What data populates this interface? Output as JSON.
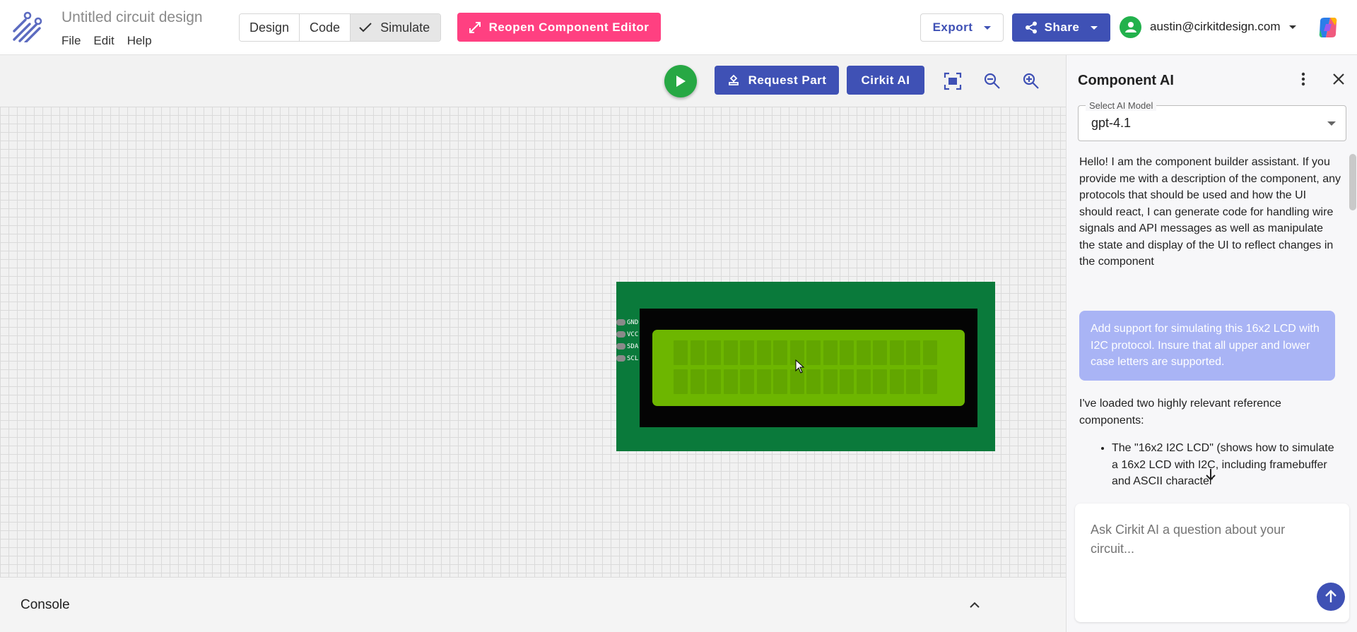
{
  "app": {
    "doc_title": "Untitled circuit design",
    "menus": [
      "File",
      "Edit",
      "Help"
    ]
  },
  "modes": {
    "design": "Design",
    "code": "Code",
    "simulate": "Simulate",
    "active": "Simulate"
  },
  "header": {
    "reopen_label": "Reopen Component Editor",
    "export_label": "Export",
    "share_label": "Share",
    "user_email": "austin@cirkitdesign.com"
  },
  "toolbar": {
    "request_part_label": "Request Part",
    "cirkit_ai_label": "Cirkit AI"
  },
  "lcd": {
    "pins": [
      "GND",
      "VCC",
      "SDA",
      "SCL"
    ],
    "columns": 16,
    "rows": 2
  },
  "console": {
    "title": "Console"
  },
  "panel": {
    "title": "Component AI",
    "model_label": "Select AI Model",
    "model_value": "gpt-4.1",
    "greeting": "Hello! I am the component builder assistant. If you provide me with a description of the component, any protocols that should be used and how the UI should react, I can generate code for handling wire signals and API messages as well as manipulate the state and display of the UI to reflect changes in the component",
    "user_message": "Add support for simulating this 16x2 LCD with I2C protocol.  Insure that all upper and lower case letters are supported.",
    "reply_intro": "I've loaded two highly relevant reference components:",
    "reply_bullet": "The \"16x2 I2C LCD\" (shows how to simulate a 16x2 LCD with I2C, including framebuffer and ASCII character",
    "input_placeholder": "Ask Cirkit AI a question about your circuit..."
  },
  "colors": {
    "primary": "#3f51b5",
    "accent_pink": "#ff4081",
    "run_green": "#27a844",
    "pcb_green": "#0a7a3b",
    "lcd_green": "#6db600",
    "user_bubble": "#a9b4f5"
  }
}
